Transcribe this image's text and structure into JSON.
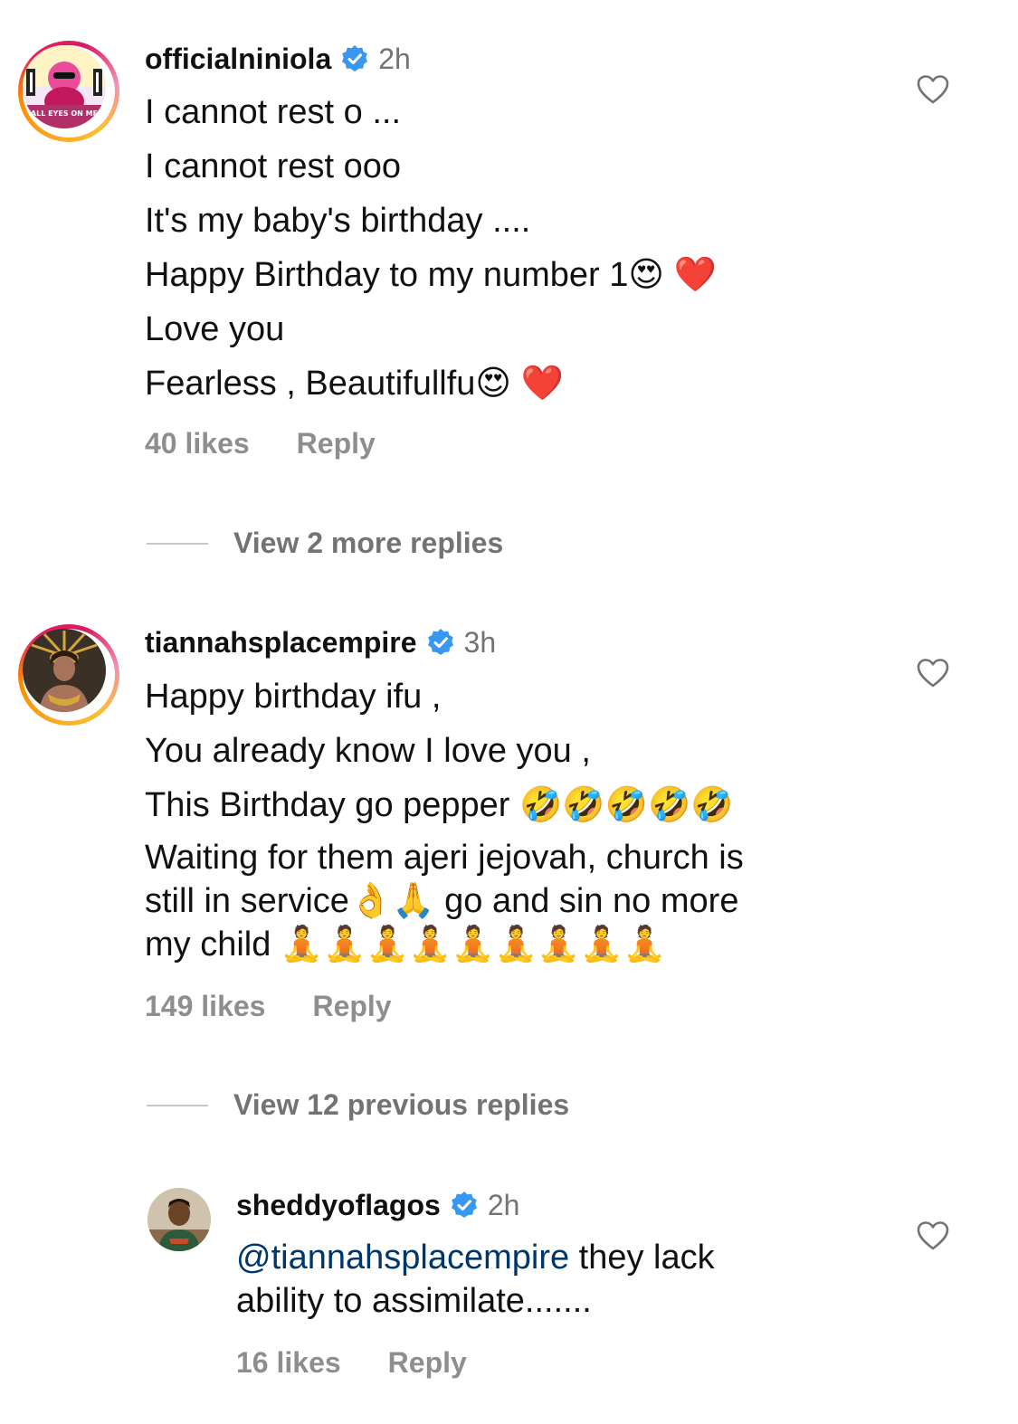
{
  "comments": [
    {
      "username": "officialniniola",
      "time": "2h",
      "lines": [
        "I cannot rest o ...",
        "I cannot rest ooo",
        "It's my baby's birthday ....",
        "Happy Birthday to my number 1😍 ❤️",
        "Love you",
        "Fearless , Beautifullfu😍 ❤️"
      ],
      "likes": "40 likes",
      "reply": "Reply",
      "view_replies": "View 2 more replies",
      "avatar_text": "ALL EYES ON ME"
    },
    {
      "username": "tiannahsplacempire",
      "time": "3h",
      "lines": [
        "Happy birthday ifu ,",
        "You already know I love you ,",
        "This Birthday go pepper 🤣🤣🤣🤣🤣",
        "Waiting for them ajeri jejovah, church is",
        "still in service👌🙏 go and sin no more",
        "my child 🧘🧘🧘🧘🧘🧘🧘🧘🧘"
      ],
      "likes": "149 likes",
      "reply": "Reply",
      "view_replies": "View 12 previous replies"
    }
  ],
  "reply": {
    "username": "sheddyoflagos",
    "time": "2h",
    "mention": "@tiannahsplacempire",
    "line1_rest": " they lack",
    "line2": "ability to assimilate.......",
    "likes": "16 likes",
    "reply": "Reply"
  },
  "colors": {
    "verified_blue": "#3897f0",
    "mention_blue": "#00376b",
    "muted_gray": "#8e8e8e"
  },
  "icons": {
    "verified": "verified-badge-icon",
    "like": "heart-outline-icon"
  }
}
